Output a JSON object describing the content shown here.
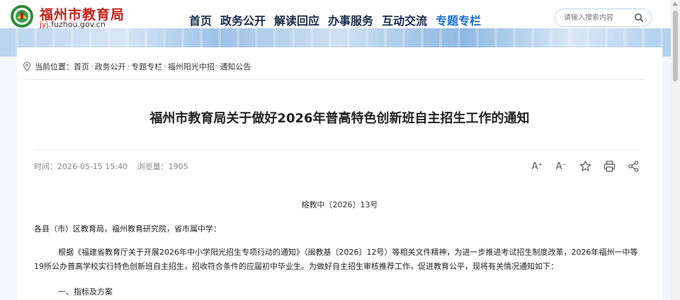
{
  "site": {
    "name": "福州市教育局",
    "url_accent": "jyj",
    "url_rest": ".fuzhou.gov.cn"
  },
  "nav": {
    "items": [
      {
        "label": "首页"
      },
      {
        "label": "政务公开"
      },
      {
        "label": "解读回应"
      },
      {
        "label": "办事服务"
      },
      {
        "label": "互动交流"
      },
      {
        "label": "专题专栏"
      }
    ],
    "active_index": 5
  },
  "search": {
    "placeholder": "请输入搜索内容"
  },
  "breadcrumb": {
    "prefix": "当前位置：",
    "items": [
      "首页",
      "政务公开",
      "专题专栏",
      "福州阳光中招",
      "通知公告"
    ]
  },
  "article": {
    "title": "福州市教育局关于做好2026年普高特色创新班自主招生工作的通知",
    "time": "时间：2026-05-15 15:40",
    "views": "浏览量：1905",
    "doc_no": "榕教中〔2026〕13号",
    "salutation": "各县（市）区教育局，福州教育研究院，省市属中学：",
    "body1": "根据《福建省教育厅关于开展2026年中小学阳光招生专项行动的通知》（闽教基〔2026〕12号）等相关文件精神，为进一步推进考试招生制度改革，2026年福州一中等19所公办普高学校实行特色创新班自主招生，招收符合条件的应届初中毕业生。为做好自主招生审核推荐工作，促进教育公平，现将有关情况通知如下：",
    "section1": "一、指标及方案"
  },
  "tools": [
    {
      "icon": "font-increase-icon",
      "label": "A⁺"
    },
    {
      "icon": "font-decrease-icon",
      "label": "A⁻"
    },
    {
      "icon": "star-icon"
    },
    {
      "icon": "print-icon"
    },
    {
      "icon": "share-icon"
    }
  ],
  "colors": {
    "brand_red": "#c0231c",
    "nav_active": "#1d6fc7",
    "nav_text": "#1a2b4a"
  }
}
